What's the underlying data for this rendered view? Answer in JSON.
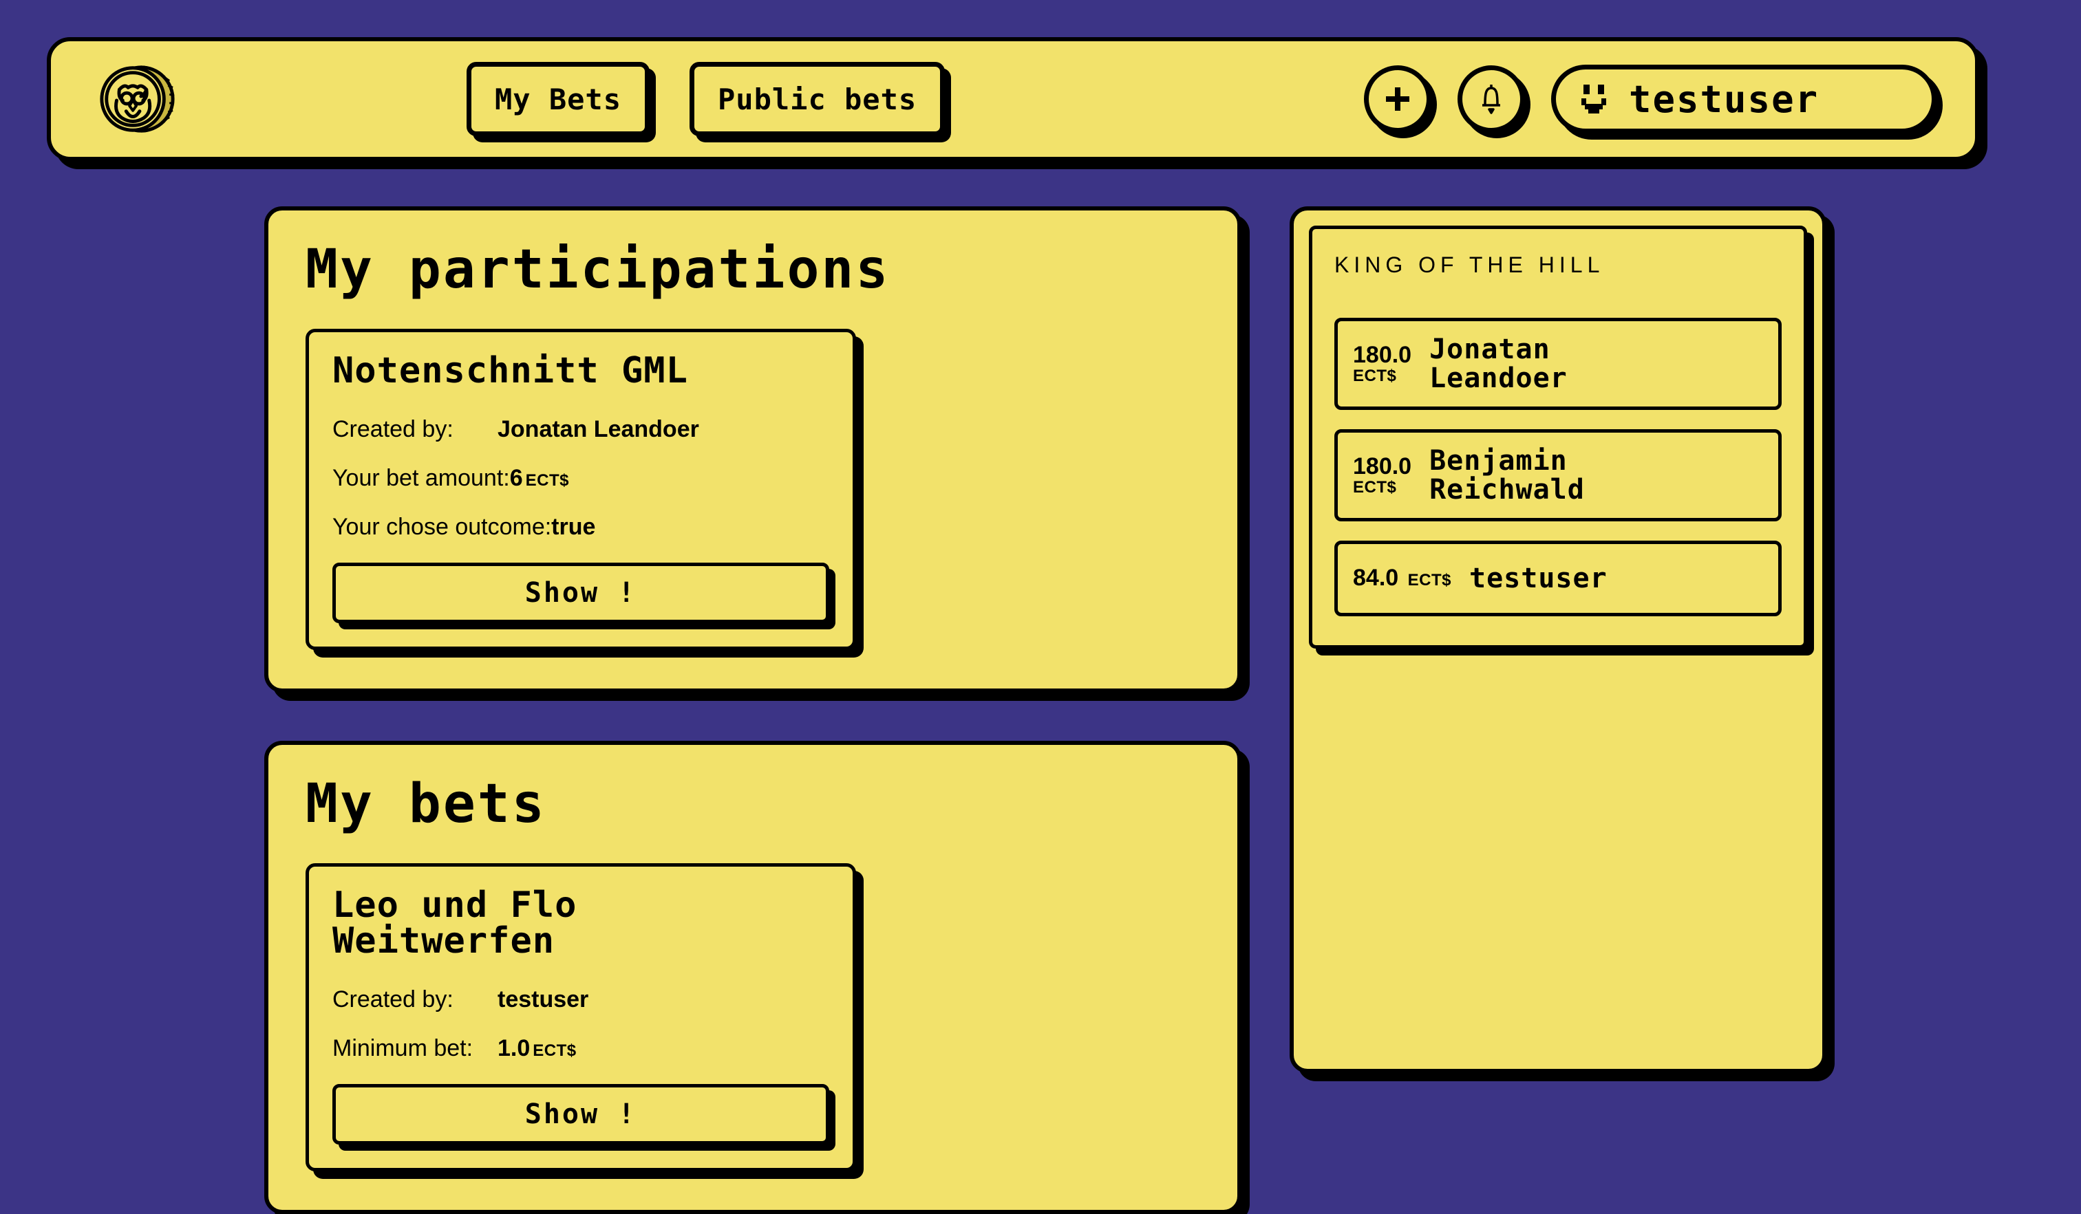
{
  "theme": {
    "background": "#3c3486",
    "surface": "#f2e26b",
    "ink": "#000000"
  },
  "header": {
    "logo_icon": "owl-coin-logo",
    "nav": [
      {
        "label": "My Bets",
        "name": "my-bets"
      },
      {
        "label": "Public bets",
        "name": "public-bets"
      }
    ],
    "actions": [
      {
        "icon": "plus-icon",
        "name": "create-bet-button"
      },
      {
        "icon": "bell-icon",
        "name": "notifications-button"
      }
    ],
    "user": {
      "avatar_icon": "smiley-face-avatar",
      "name": "testuser"
    }
  },
  "participations": {
    "title": "My participations",
    "cards": [
      {
        "title": "Notenschnitt GML",
        "rows": [
          {
            "label": "Created by:",
            "value": "Jonatan Leandoer",
            "unit": ""
          },
          {
            "label": "Your bet amount:",
            "value": "6",
            "unit": "ECT$"
          },
          {
            "label": "Your chose outcome:",
            "value": "true",
            "unit": ""
          }
        ],
        "action": "Show !"
      }
    ]
  },
  "mybets": {
    "title": "My bets",
    "cards": [
      {
        "title": "Leo und Flo Weitwerfen",
        "rows": [
          {
            "label": "Created by:",
            "value": "testuser",
            "unit": ""
          },
          {
            "label": "Minimum bet:",
            "value": "1.0",
            "unit": "ECT$"
          }
        ],
        "action": "Show !"
      }
    ]
  },
  "king_of_the_hill": {
    "title": "KING OF THE HILL",
    "rows": [
      {
        "amount": "180.0",
        "unit": "ECT$",
        "name": "Jonatan Leandoer",
        "stacked": true
      },
      {
        "amount": "180.0",
        "unit": "ECT$",
        "name": "Benjamin Reichwald",
        "stacked": true
      },
      {
        "amount": "84.0",
        "unit": "ECT$",
        "name": "testuser",
        "stacked": false
      }
    ]
  }
}
